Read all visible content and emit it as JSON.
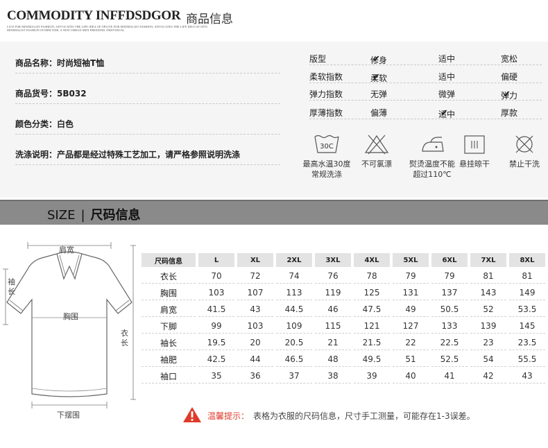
{
  "header": {
    "brand": "COMMODITY INFFDSDGOR",
    "brand_cn": "商品信息",
    "tagline_line1": "LIVE FOR MINIMALIST FASHION, ADVOCATES THE LIFE IDEA OF OPLIVE FOR MINIMALIST FASHION, ADVOCATES THE LIFE IDEA OF OPTI",
    "tagline_line2": "MINIMALIST FASHION STORM TIDE, A NEW URBAN MEN FREEDOM, INDIVIDUAL"
  },
  "info": {
    "name_label": "商品名称：",
    "name_value": "时尚短袖T恤",
    "code_label": "商品货号：",
    "code_value": "5B032",
    "color_label": "颜色分类：",
    "color_value": "白色",
    "wash_label": "洗涤说明：",
    "wash_value": "产品都是经过特殊工艺加工，请严格参照说明洗涤"
  },
  "properties": [
    {
      "label": "版型",
      "options": [
        "修身",
        "适中",
        "宽松"
      ],
      "checked": 0
    },
    {
      "label": "柔软指数",
      "options": [
        "柔软",
        "适中",
        "偏硬"
      ],
      "checked": 0
    },
    {
      "label": "弹力指数",
      "options": [
        "无弹",
        "微弹",
        "弹力"
      ],
      "checked": 2
    },
    {
      "label": "厚薄指数",
      "options": [
        "偏薄",
        "适中",
        "厚款"
      ],
      "checked": 1
    }
  ],
  "check_mark": "✔",
  "care": {
    "wash_icon_text": "30C",
    "wash_label_1": "最高水温30度",
    "wash_label_2": "常规洗涤",
    "nobleach_label": "不可氯漂",
    "iron_label_1": "熨烫温度不能",
    "iron_label_2": "超过110℃",
    "hang_label": "悬挂晾干",
    "nodry_label": "禁止干洗"
  },
  "size_banner": {
    "en": "SIZE",
    "sep": "|",
    "cn": "尺码信息"
  },
  "diagram": {
    "shoulder": "肩宽",
    "chest": "胸围",
    "hem": "下摆围",
    "sleeve": "袖长",
    "length": "衣长"
  },
  "size_table": {
    "headers": [
      "尺码信息",
      "L",
      "XL",
      "2XL",
      "3XL",
      "4XL",
      "5XL",
      "6XL",
      "7XL",
      "8XL"
    ],
    "rows": [
      {
        "label": "衣长",
        "values": [
          "70",
          "72",
          "74",
          "76",
          "78",
          "79",
          "79",
          "81",
          "81"
        ]
      },
      {
        "label": "胸围",
        "values": [
          "103",
          "107",
          "113",
          "119",
          "125",
          "131",
          "137",
          "143",
          "149"
        ]
      },
      {
        "label": "肩宽",
        "values": [
          "41.5",
          "43",
          "44.5",
          "46",
          "47.5",
          "49",
          "50.5",
          "52",
          "53.5"
        ]
      },
      {
        "label": "下脚",
        "values": [
          "99",
          "103",
          "109",
          "115",
          "121",
          "127",
          "133",
          "139",
          "145"
        ]
      },
      {
        "label": "袖长",
        "values": [
          "19.5",
          "20",
          "20.5",
          "21",
          "21.5",
          "22",
          "22.5",
          "23",
          "23.5"
        ]
      },
      {
        "label": "袖肥",
        "values": [
          "42.5",
          "44",
          "46.5",
          "48",
          "49.5",
          "51",
          "52.5",
          "54",
          "55.5"
        ]
      },
      {
        "label": "袖口",
        "values": [
          "35",
          "36",
          "37",
          "38",
          "39",
          "40",
          "41",
          "42",
          "43"
        ]
      }
    ]
  },
  "tip": {
    "title": "温馨提示：",
    "text": "表格为衣服的尺码信息，尺寸手工测量，可能存在1-3误差。"
  },
  "colors": {
    "panel_bg": "#f5f5f5",
    "banner_bg": "#8a8a8a",
    "table_header_bg": "#e3e3e3",
    "tip_red": "#e03a2a"
  }
}
